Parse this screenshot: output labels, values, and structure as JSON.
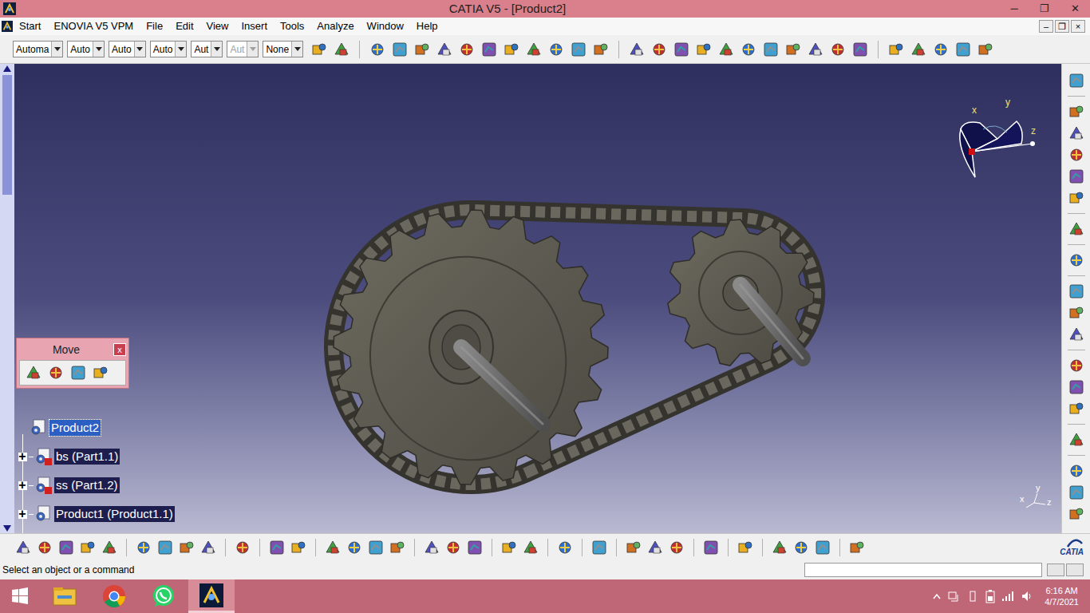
{
  "window": {
    "title": "CATIA V5 - [Product2]",
    "controls": [
      "─",
      "❐",
      "✕"
    ]
  },
  "menu": {
    "items": [
      "Start",
      "ENOVIA V5 VPM",
      "File",
      "Edit",
      "View",
      "Insert",
      "Tools",
      "Analyze",
      "Window",
      "Help"
    ],
    "mdi_controls": [
      "–",
      "❐",
      "×"
    ]
  },
  "toolbar": {
    "dropdowns": [
      {
        "value": "Automa",
        "disabled": false
      },
      {
        "value": "Auto",
        "disabled": false
      },
      {
        "value": "Auto",
        "disabled": false
      },
      {
        "value": "Auto",
        "disabled": false
      },
      {
        "value": "Aut",
        "disabled": false
      },
      {
        "value": "Aut",
        "disabled": true
      },
      {
        "value": "None",
        "disabled": false
      }
    ]
  },
  "compass": {
    "labels": [
      "x",
      "y",
      "z"
    ]
  },
  "move_toolbar": {
    "title": "Move",
    "close": "x"
  },
  "tree": [
    {
      "label": "Product2",
      "selected": true,
      "current": true
    },
    {
      "label": "bs (Part1.1)",
      "expander": "+",
      "selected": true,
      "current": false
    },
    {
      "label": "ss (Part1.2)",
      "expander": "+",
      "selected": true,
      "current": false
    },
    {
      "label": "Product1 (Product1.1)",
      "expander": "+",
      "selected": true,
      "current": false
    }
  ],
  "axis": {
    "labels": [
      "y",
      "x",
      "z"
    ]
  },
  "logo": "CATIA",
  "status_bar": {
    "message": "Select an object or a command"
  },
  "taskbar": {
    "time": "6:16 AM",
    "date": "4/7/2021"
  }
}
